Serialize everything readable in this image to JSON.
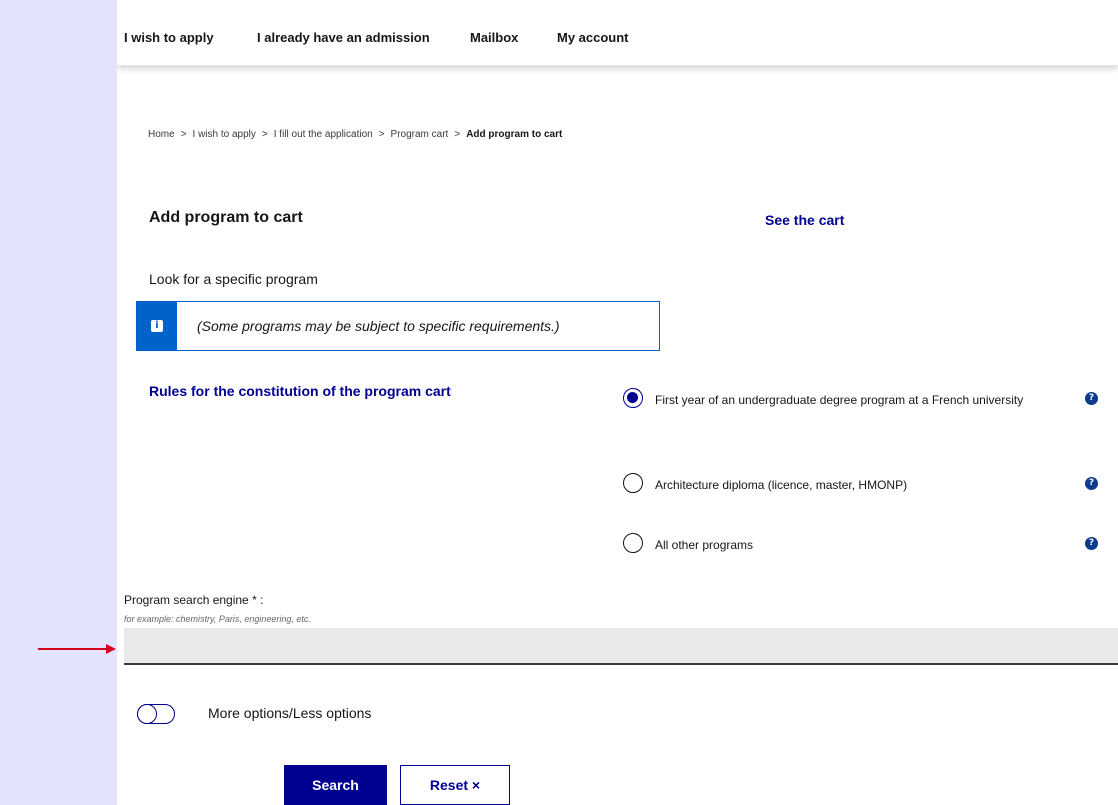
{
  "nav": {
    "items": [
      "I wish to apply",
      "I already have an admission",
      "Mailbox",
      "My account"
    ]
  },
  "breadcrumb": {
    "items": [
      "Home",
      "I wish to apply",
      "I fill out the application",
      "Program cart"
    ],
    "current": "Add program to cart",
    "separator": ">"
  },
  "main": {
    "title": "Add program to cart",
    "see_cart": "See the cart",
    "look_for": "Look for a specific program",
    "notice": "(Some programs may be subject to specific requirements.)",
    "rules_link": "Rules for the constitution of the program cart"
  },
  "program_types": {
    "options": [
      {
        "label": "First year of an undergraduate degree program at a French university",
        "checked": true
      },
      {
        "label": "Architecture diploma (licence, master, HMONP)",
        "checked": false
      },
      {
        "label": "All other programs",
        "checked": false
      }
    ],
    "help_glyph": "?"
  },
  "search": {
    "label": "Program search engine * :",
    "hint": "for example: chemistry, Paris, engineering, etc.",
    "value": "",
    "placeholder": ""
  },
  "options_toggle": {
    "label": "More options/Less options",
    "on": false
  },
  "buttons": {
    "search": "Search",
    "reset": "Reset ×"
  },
  "icons": {
    "info": "i",
    "help": "?"
  },
  "colors": {
    "primary": "#000091",
    "info_blue": "#0063cb",
    "page_background": "#e3e3fb",
    "annotation_arrow": "#d0021b"
  }
}
